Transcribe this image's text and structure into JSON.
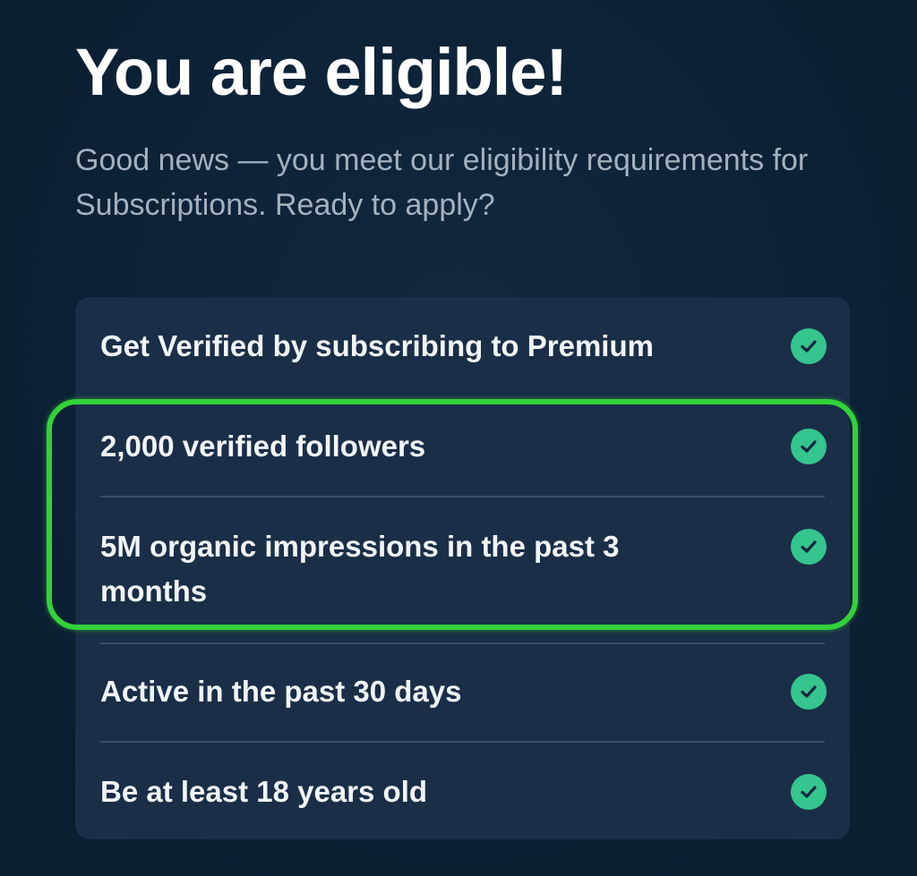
{
  "header": {
    "title": "You are eligible!",
    "subtitle": "Good news — you meet our eligibility requirements for Subscriptions. Ready to apply?"
  },
  "requirements": [
    {
      "label": "Get Verified by subscribing to Premium",
      "status": "met"
    },
    {
      "label": "2,000 verified followers",
      "status": "met"
    },
    {
      "label": "5M organic impressions in the past 3 months",
      "status": "met"
    },
    {
      "label": "Active in the past 30 days",
      "status": "met"
    },
    {
      "label": "Be at least 18 years old",
      "status": "met"
    }
  ],
  "colors": {
    "background": "#0e2338",
    "card": "#1a2e47",
    "check": "#35c58e",
    "highlight": "#32d23a"
  },
  "icons": {
    "check": "check-circle-icon"
  }
}
